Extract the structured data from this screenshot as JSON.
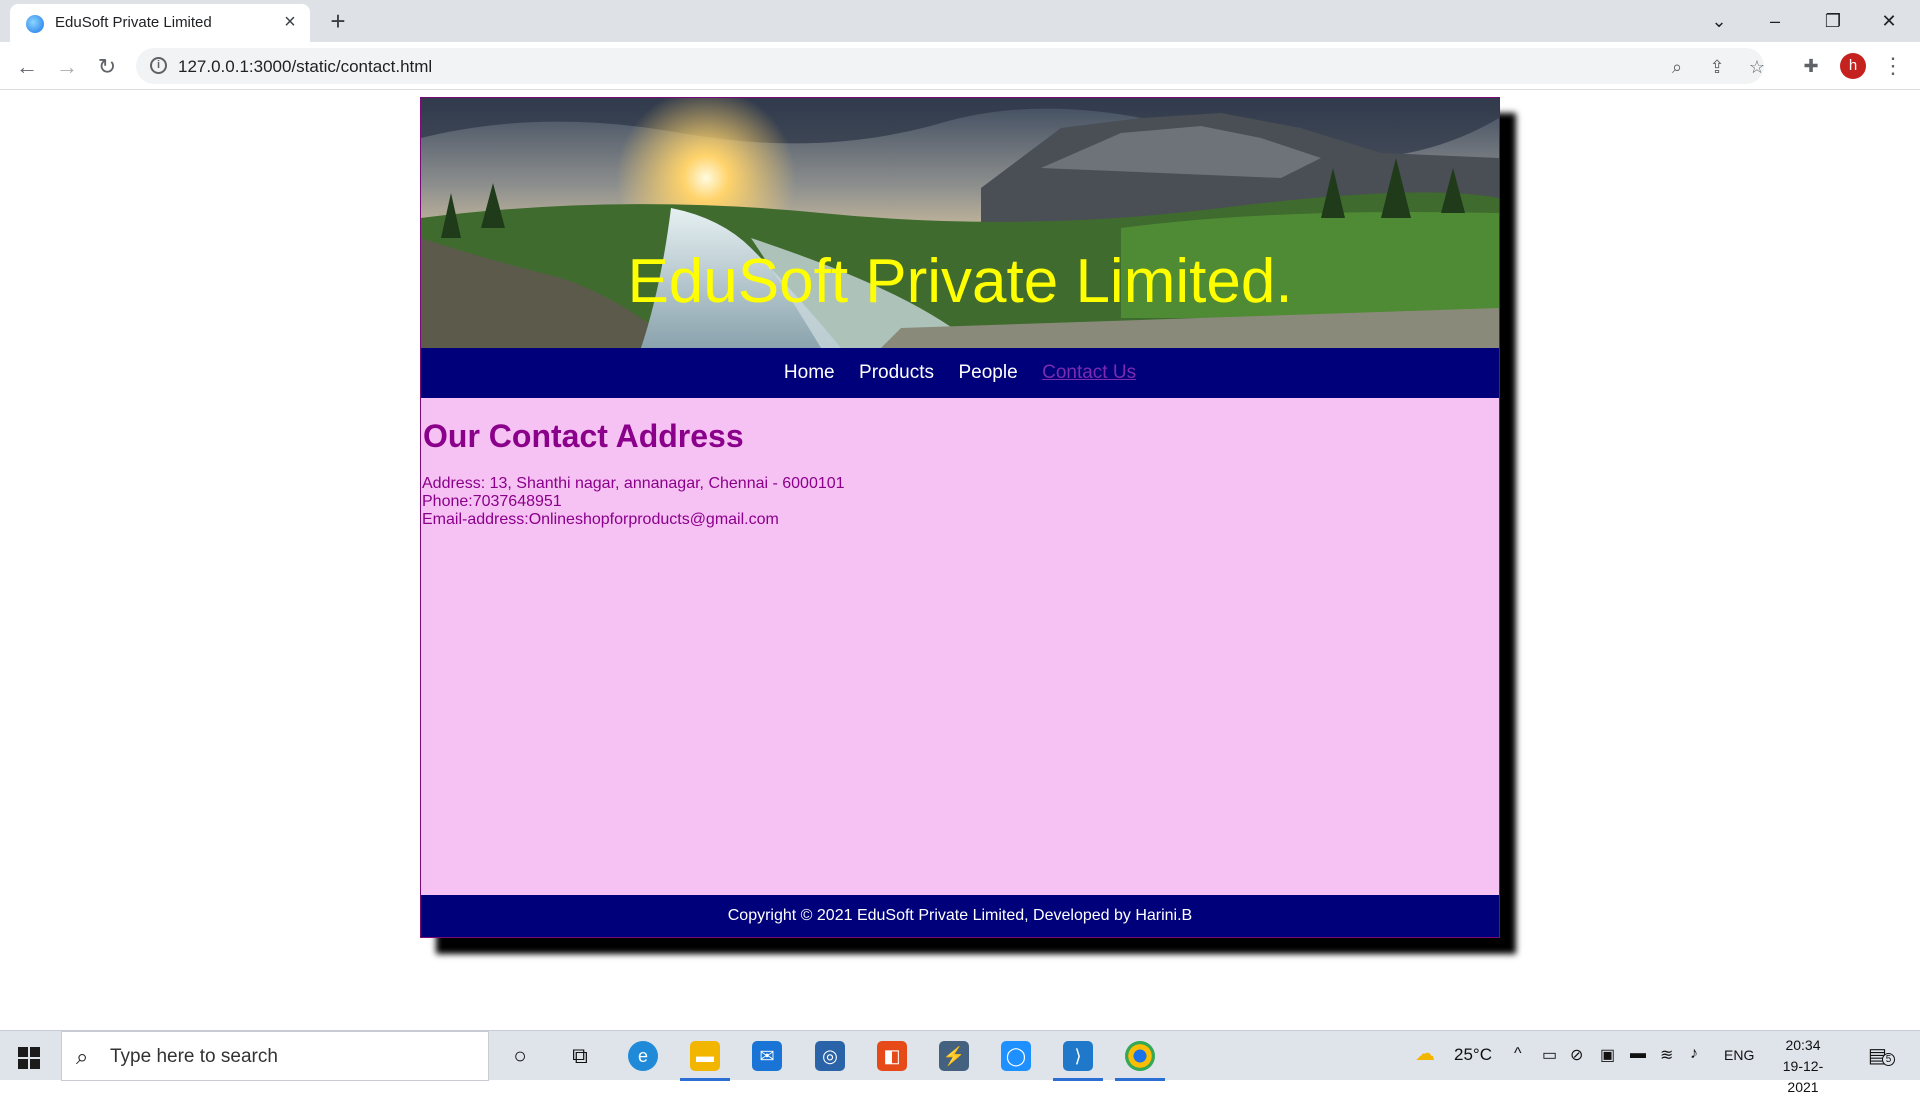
{
  "browser": {
    "tab_title": "EduSoft Private Limited",
    "new_tab": "+",
    "url": "127.0.0.1:3000/static/contact.html",
    "profile_initial": "h"
  },
  "site": {
    "title": "EduSoft Private Limited.",
    "nav": [
      {
        "label": "Home"
      },
      {
        "label": "Products"
      },
      {
        "label": "People"
      },
      {
        "label": "Contact Us"
      }
    ],
    "heading": "Our Contact Address",
    "address": "Address: 13, Shanthi nagar, annanagar, Chennai - 6000101",
    "phone": "Phone:7037648951",
    "email": "Email-address:Onlineshopforproducts@gmail.com",
    "footer": "Copyright © 2021 EduSoft Private Limited, Developed by Harini.B"
  },
  "taskbar": {
    "search_placeholder": "Type here to search",
    "temperature": "25°C",
    "language": "ENG",
    "time": "20:34",
    "date": "19-12-2021",
    "notification_count": "5"
  },
  "colors": {
    "banner_title": "#ffff00",
    "navbar_bg": "#00007a",
    "content_bg": "#f6c1f3",
    "heading": "#8b008b",
    "active_link": "#7b2bb0"
  }
}
